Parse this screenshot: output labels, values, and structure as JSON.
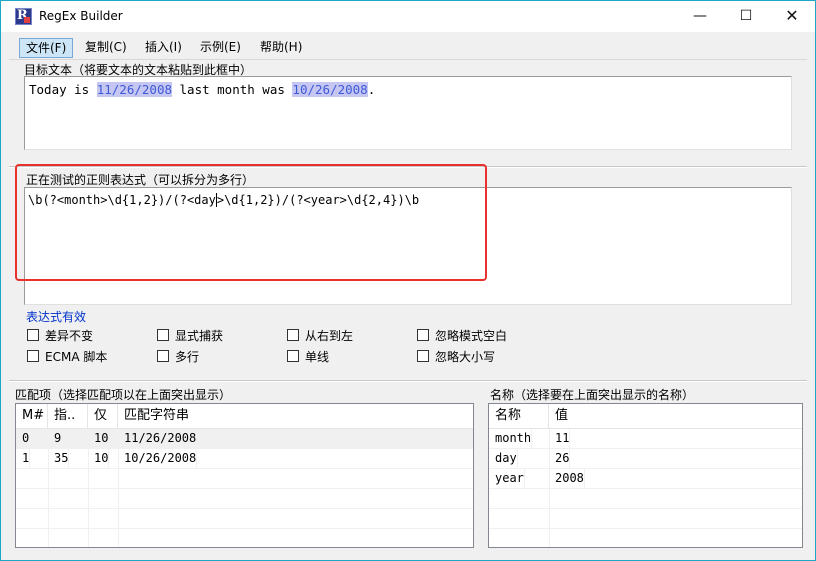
{
  "window": {
    "title": "RegEx Builder",
    "app_icon_letter": "R",
    "minimize_glyph": "—",
    "maximize_glyph": "☐",
    "close_glyph": "✕"
  },
  "menu": [
    {
      "label": "文件(F)",
      "active": true
    },
    {
      "label": "复制(C)",
      "active": false
    },
    {
      "label": "插入(I)",
      "active": false
    },
    {
      "label": "示例(E)",
      "active": false
    },
    {
      "label": "帮助(H)",
      "active": false
    }
  ],
  "target": {
    "label": "目标文本（将要文本的文本粘贴到此框中）",
    "segments": [
      {
        "text": "Today is ",
        "hl": false
      },
      {
        "text": "11/26/2008",
        "hl": true
      },
      {
        "text": " last month was ",
        "hl": false
      },
      {
        "text": "10/26/2008",
        "hl": true
      },
      {
        "text": ".",
        "hl": false
      }
    ]
  },
  "regex": {
    "label": "正在测试的正则表达式（可以拆分为多行）",
    "before_caret": "\\b(?<month>\\d{1,2})/(?<day",
    "after_caret": ">\\d{1,2})/(?<year>\\d{2,4})\\b"
  },
  "status": {
    "text": "表达式有效",
    "color": "#0033cc"
  },
  "options": [
    {
      "label": "差异不变",
      "checked": false
    },
    {
      "label": "显式捕获",
      "checked": false
    },
    {
      "label": "从右到左",
      "checked": false
    },
    {
      "label": "忽略模式空白",
      "checked": false
    },
    {
      "label": "ECMA 脚本",
      "checked": false
    },
    {
      "label": "多行",
      "checked": false
    },
    {
      "label": "单线",
      "checked": false
    },
    {
      "label": "忽略大小写",
      "checked": false
    }
  ],
  "matches": {
    "label": "匹配项（选择匹配项以在上面突出显示）",
    "columns": [
      "M#",
      "指..",
      "仅",
      "匹配字符串"
    ],
    "rows": [
      [
        "0",
        "9",
        "10",
        "11/26/2008"
      ],
      [
        "1",
        "35",
        "10",
        "10/26/2008"
      ]
    ]
  },
  "names": {
    "label": "名称（选择要在上面突出显示的名称）",
    "columns": [
      "名称",
      "值"
    ],
    "rows": [
      [
        "month",
        "11"
      ],
      [
        "day",
        "26"
      ],
      [
        "year",
        "2008"
      ]
    ]
  },
  "colors": {
    "highlight_bg": "#c6c6f2",
    "highlight_fg": "#3d5ad8",
    "annotation_red": "#e8302c",
    "window_border": "#1aa9c4"
  }
}
